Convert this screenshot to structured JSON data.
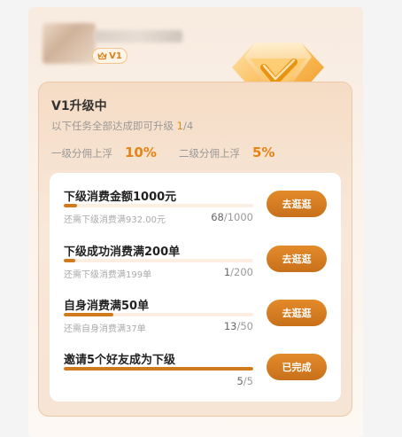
{
  "user": {
    "level": "V1"
  },
  "upgrade": {
    "title": "V1升级中",
    "subtitle_prefix": "以下任务全部达成即可升级",
    "progress_done": "1",
    "progress_sep": "/",
    "progress_total": "4",
    "rates": [
      {
        "label": "一级分佣上浮",
        "value": "10%"
      },
      {
        "label": "二级分佣上浮",
        "value": "5%"
      }
    ]
  },
  "tasks": [
    {
      "title": "下级消费金额1000元",
      "hint": "还需下级消费满932.00元",
      "current": "68",
      "total": "/1000",
      "progress": 0.068,
      "button": "去逛逛"
    },
    {
      "title": "下级成功消费满200单",
      "hint": "还需下级消费满199单",
      "current": "1",
      "total": "/200",
      "progress": 0.005,
      "button": "去逛逛"
    },
    {
      "title": "自身消费满50单",
      "hint": "还需自身消费满37单",
      "current": "13",
      "total": "/50",
      "progress": 0.26,
      "button": "去逛逛"
    },
    {
      "title": "邀请5个好友成为下级",
      "hint": "",
      "current": "5",
      "total": "/5",
      "progress": 1.0,
      "button": "已完成"
    }
  ],
  "colors": {
    "accent": "#e58416",
    "button": "#d07a1e",
    "track": "#fcefe2"
  },
  "icons": {
    "badge": "crown-icon",
    "emblem": "diamond-check-icon"
  }
}
